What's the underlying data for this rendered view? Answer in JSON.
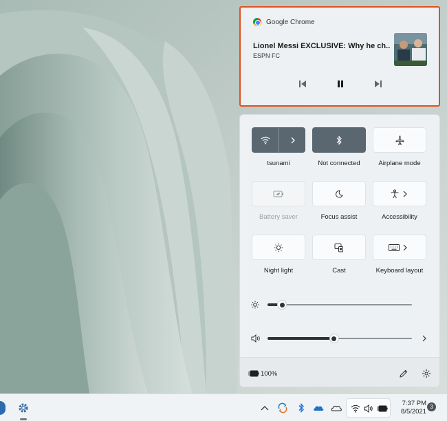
{
  "media": {
    "app_name": "Google Chrome",
    "title": "Lionel Messi EXCLUSIVE: Why he ch...",
    "source": "ESPN FC",
    "controls": [
      "previous-track",
      "pause",
      "next-track"
    ]
  },
  "quick_settings": {
    "tiles": [
      {
        "id": "wifi",
        "label": "tsunami",
        "icon": "wifi-icon",
        "state": "on",
        "has_chevron": true
      },
      {
        "id": "bluetooth",
        "label": "Not connected",
        "icon": "bluetooth-icon",
        "state": "on",
        "has_chevron": false
      },
      {
        "id": "airplane",
        "label": "Airplane mode",
        "icon": "airplane-icon",
        "state": "off",
        "has_chevron": false
      },
      {
        "id": "battery-saver",
        "label": "Battery saver",
        "icon": "battery-saver-icon",
        "state": "disabled",
        "has_chevron": false
      },
      {
        "id": "focus",
        "label": "Focus assist",
        "icon": "moon-icon",
        "state": "off",
        "has_chevron": false
      },
      {
        "id": "accessibility",
        "label": "Accessibility",
        "icon": "accessibility-icon",
        "state": "off",
        "has_chevron": true
      },
      {
        "id": "night-light",
        "label": "Night light",
        "icon": "sun-icon",
        "state": "off",
        "has_chevron": false
      },
      {
        "id": "cast",
        "label": "Cast",
        "icon": "cast-icon",
        "state": "off",
        "has_chevron": false
      },
      {
        "id": "keyboard",
        "label": "Keyboard layout",
        "icon": "keyboard-icon",
        "state": "off",
        "has_chevron": true
      }
    ],
    "brightness": {
      "level": 0.1,
      "icon": "brightness-icon"
    },
    "volume": {
      "level": 0.46,
      "icon": "speaker-icon"
    },
    "battery_percent": "100%"
  },
  "taskbar": {
    "time": "7:37 PM",
    "date": "8/5/2021",
    "notification_count": "3"
  },
  "colors": {
    "highlight_border": "#e0501f",
    "tile_on": "#5a6670",
    "panel_bg": "#eef1f3"
  }
}
